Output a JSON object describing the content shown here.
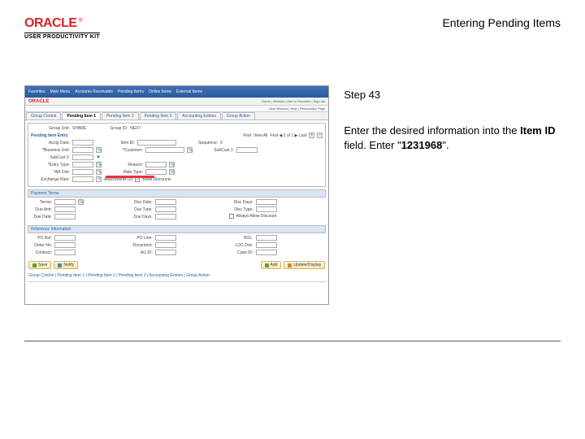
{
  "header": {
    "brand": "ORACLE",
    "product": "USER PRODUCTIVITY KIT",
    "doc_title": "Entering Pending Items"
  },
  "instruction": {
    "step_label": "Step 43",
    "text_prefix": "Enter the desired information into the ",
    "field_name": "Item ID",
    "text_mid": " field. Enter \"",
    "value": "1231968",
    "text_suffix": "\"."
  },
  "screenshot": {
    "topbar": [
      "Favorites",
      "Main Menu",
      "Accounts Receivable",
      "Pending Items",
      "Online Items",
      "External Items"
    ],
    "brand": "ORACLE",
    "right_links": "Home | Worklist | Add to Favorites | Sign out",
    "subbar": "New Window | Help | Personalize Page",
    "tabs": [
      "Group Control",
      "Pending Item 1",
      "Pending Item 2",
      "Pending Item 3",
      "Accounting Entries",
      "Group Action"
    ],
    "active_tab_index": 1,
    "section1": {
      "row1": {
        "l1": "Group Unit:",
        "v1": "SHARE",
        "l2": "Group ID:",
        "v2": "NEXT"
      },
      "entry_title": "Pending Item Entry",
      "nav": "First  ◀  1 of 1  ▶  Last",
      "view_all": "View All",
      "find": "Find",
      "rows": [
        {
          "l1": "Acctg Date:",
          "l2": "Item ID:",
          "l3": "Sequence:",
          "v3": "2"
        },
        {
          "l1": "*Business Unit:",
          "l2": "*Customer:",
          "l3": "SubCust 1:"
        },
        {
          "l1": "SubCust 2:"
        },
        {
          "l1": "*Entry Type:",
          "l2": "Reason:"
        },
        {
          "l1": "*AR Dist:",
          "l2": "Rate Type:"
        },
        {
          "l1": "Exchange Rate:",
          "cb": "Attachments (0)",
          "cb2": "Allow Discounts"
        }
      ]
    },
    "section2": {
      "head": "Payment Terms",
      "rows": [
        {
          "l1": "Terms:",
          "l2": "Disc Date:",
          "l3": "Disc Days:"
        },
        {
          "l1": "Due Amt:",
          "l2": "Due Type:",
          "l3": "Disc Type:"
        },
        {
          "l1": "Due Date:",
          "l2": "Due Days:",
          "cb": "Always Allow Discount"
        }
      ]
    },
    "section3": {
      "head": "Reference Information",
      "rows": [
        {
          "l1": "PO Ref:",
          "l2": "PO Line:",
          "l3": "BOL:"
        },
        {
          "l1": "Order No:",
          "l2": "Document:",
          "l3": "LOC Doc:"
        },
        {
          "l1": "Contract:",
          "l2": "AG ID:",
          "l3": "Case ID:"
        }
      ]
    },
    "buttons": {
      "save": "Save",
      "notify": "Notify",
      "add": "Add",
      "update": "Update/Display"
    },
    "footer": "Group Control | Pending Item 1 | Pending Item 2 | Pending Item 3 | Accounting Entries | Group Action"
  }
}
